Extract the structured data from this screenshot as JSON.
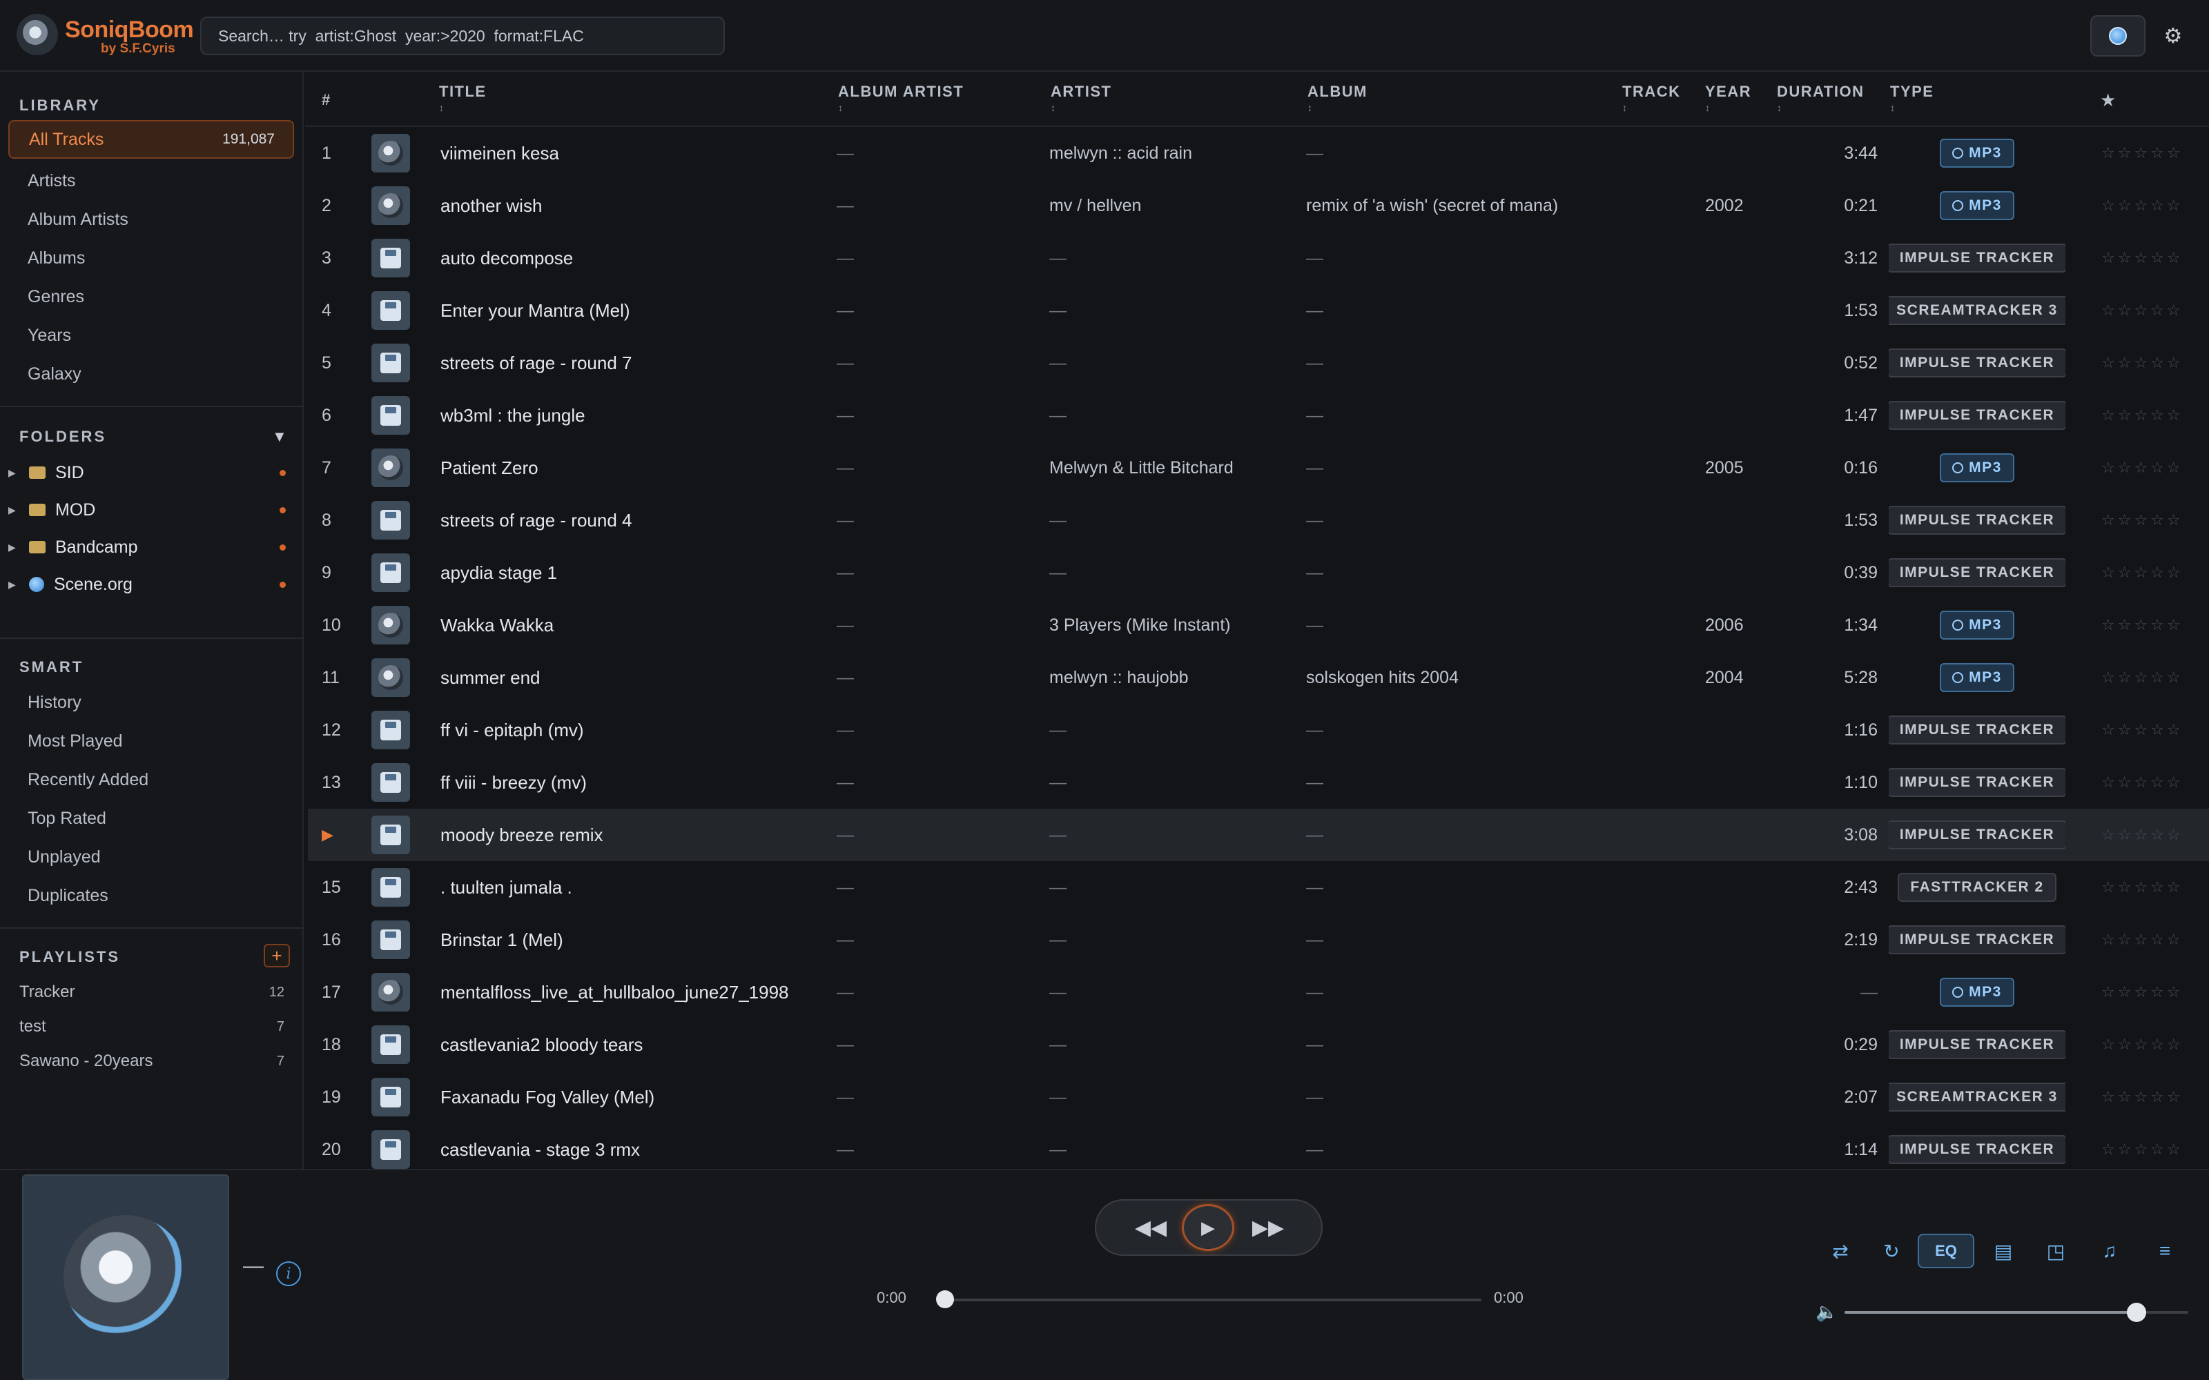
{
  "app": {
    "brand": "SoniqBoom",
    "brand_sub": "by S.F.Cyris",
    "search_placeholder": "Search… try  artist:Ghost  year:>2020  format:FLAC"
  },
  "sidebar": {
    "library_title": "LIBRARY",
    "library_items": [
      {
        "label": "All Tracks",
        "count": "191,087"
      },
      {
        "label": "Artists"
      },
      {
        "label": "Album Artists"
      },
      {
        "label": "Albums"
      },
      {
        "label": "Genres"
      },
      {
        "label": "Years"
      },
      {
        "label": "Galaxy"
      }
    ],
    "folders_title": "FOLDERS",
    "folders_toggle": "▼",
    "folders": [
      {
        "label": "SID"
      },
      {
        "label": "MOD"
      },
      {
        "label": "Bandcamp"
      },
      {
        "label": "Scene.org"
      }
    ],
    "smart_title": "SMART",
    "smart_items": [
      "History",
      "Most Played",
      "Recently Added",
      "Top Rated",
      "Unplayed",
      "Duplicates"
    ],
    "playlists_title": "PLAYLISTS",
    "playlist_add": "+",
    "playlists": [
      {
        "label": "Tracker",
        "count": "12"
      },
      {
        "label": "test",
        "count": "7"
      },
      {
        "label": "Sawano - 20years",
        "count": "7"
      }
    ]
  },
  "table": {
    "headers": {
      "num": "#",
      "title": "TITLE",
      "album_artist": "ALBUM ARTIST",
      "artist": "ARTIST",
      "album": "ALBUM",
      "track": "TRACK",
      "year": "YEAR",
      "duration": "DURATION",
      "type": "TYPE",
      "rating": "★"
    },
    "sort_glyph": "↕",
    "dash": "—",
    "stars": "☆☆☆☆☆",
    "play_indicator": "▶",
    "rows": [
      {
        "num": "1",
        "title": "viimeinen kesa",
        "artist": "melwyn :: acid rain",
        "album": "—",
        "year": "",
        "duration": "3:44",
        "type": "MP3",
        "kind": "mp3"
      },
      {
        "num": "2",
        "title": "another wish",
        "artist": "mv / hellven",
        "album": "remix of 'a wish' (secret of mana)",
        "year": "2002",
        "duration": "0:21",
        "type": "MP3",
        "kind": "mp3"
      },
      {
        "num": "3",
        "title": "auto decompose",
        "artist": "—",
        "album": "—",
        "year": "",
        "duration": "3:12",
        "type": "IMPULSE TRACKER",
        "kind": "trk"
      },
      {
        "num": "4",
        "title": "Enter your Mantra (Mel)",
        "artist": "—",
        "album": "—",
        "year": "",
        "duration": "1:53",
        "type": "SCREAMTRACKER 3",
        "kind": "trk"
      },
      {
        "num": "5",
        "title": "streets of rage - round 7",
        "artist": "—",
        "album": "—",
        "year": "",
        "duration": "0:52",
        "type": "IMPULSE TRACKER",
        "kind": "trk"
      },
      {
        "num": "6",
        "title": "wb3ml : the jungle",
        "artist": "—",
        "album": "—",
        "year": "",
        "duration": "1:47",
        "type": "IMPULSE TRACKER",
        "kind": "trk"
      },
      {
        "num": "7",
        "title": "Patient Zero",
        "artist": "Melwyn & Little Bitchard",
        "album": "—",
        "year": "2005",
        "duration": "0:16",
        "type": "MP3",
        "kind": "mp3"
      },
      {
        "num": "8",
        "title": "streets of rage - round 4",
        "artist": "—",
        "album": "—",
        "year": "",
        "duration": "1:53",
        "type": "IMPULSE TRACKER",
        "kind": "trk"
      },
      {
        "num": "9",
        "title": "apydia stage 1",
        "artist": "—",
        "album": "—",
        "year": "",
        "duration": "0:39",
        "type": "IMPULSE TRACKER",
        "kind": "trk"
      },
      {
        "num": "10",
        "title": "Wakka Wakka",
        "artist": "3 Players (Mike Instant)",
        "album": "—",
        "year": "2006",
        "duration": "1:34",
        "type": "MP3",
        "kind": "mp3"
      },
      {
        "num": "11",
        "title": "summer end",
        "artist": "melwyn :: haujobb",
        "album": "solskogen hits 2004",
        "year": "2004",
        "duration": "5:28",
        "type": "MP3",
        "kind": "mp3"
      },
      {
        "num": "12",
        "title": "ff vi - epitaph (mv)",
        "artist": "—",
        "album": "—",
        "year": "",
        "duration": "1:16",
        "type": "IMPULSE TRACKER",
        "kind": "trk"
      },
      {
        "num": "13",
        "title": "ff viii - breezy (mv)",
        "artist": "—",
        "album": "—",
        "year": "",
        "duration": "1:10",
        "type": "IMPULSE TRACKER",
        "kind": "trk"
      },
      {
        "num": "",
        "title": "moody breeze remix",
        "artist": "—",
        "album": "—",
        "year": "",
        "duration": "3:08",
        "type": "IMPULSE TRACKER",
        "kind": "trk",
        "playing": true
      },
      {
        "num": "15",
        "title": ". tuulten jumala .",
        "artist": "—",
        "album": "—",
        "year": "",
        "duration": "2:43",
        "type": "FASTTRACKER 2",
        "kind": "trk"
      },
      {
        "num": "16",
        "title": "Brinstar 1 (Mel)",
        "artist": "—",
        "album": "—",
        "year": "",
        "duration": "2:19",
        "type": "IMPULSE TRACKER",
        "kind": "trk"
      },
      {
        "num": "17",
        "title": "mentalfloss_live_at_hullbaloo_june27_1998",
        "artist": "—",
        "album": "—",
        "year": "",
        "duration": "—",
        "type": "MP3",
        "kind": "mp3"
      },
      {
        "num": "18",
        "title": "castlevania2 bloody tears",
        "artist": "—",
        "album": "—",
        "year": "",
        "duration": "0:29",
        "type": "IMPULSE TRACKER",
        "kind": "trk"
      },
      {
        "num": "19",
        "title": "Faxanadu Fog Valley (Mel)",
        "artist": "—",
        "album": "—",
        "year": "",
        "duration": "2:07",
        "type": "SCREAMTRACKER 3",
        "kind": "trk"
      },
      {
        "num": "20",
        "title": "castlevania - stage 3 rmx",
        "artist": "—",
        "album": "—",
        "year": "",
        "duration": "1:14",
        "type": "IMPULSE TRACKER",
        "kind": "trk"
      }
    ]
  },
  "player": {
    "now_title": "—",
    "info": "i",
    "prev": "◀◀",
    "play": "▶",
    "next": "▶▶",
    "time_current": "0:00",
    "time_total": "0:00",
    "eq_label": "EQ",
    "volume": 0.85
  },
  "icons": {
    "settings": "⚙",
    "shuffle": "⇄",
    "repeat": "↻",
    "lyrics": "▤",
    "cast": "◳",
    "music": "♫",
    "queue": "≡",
    "volume": "🔈"
  },
  "colors": {
    "accent": "#e8793a",
    "mp3": "#9fd0ff"
  }
}
